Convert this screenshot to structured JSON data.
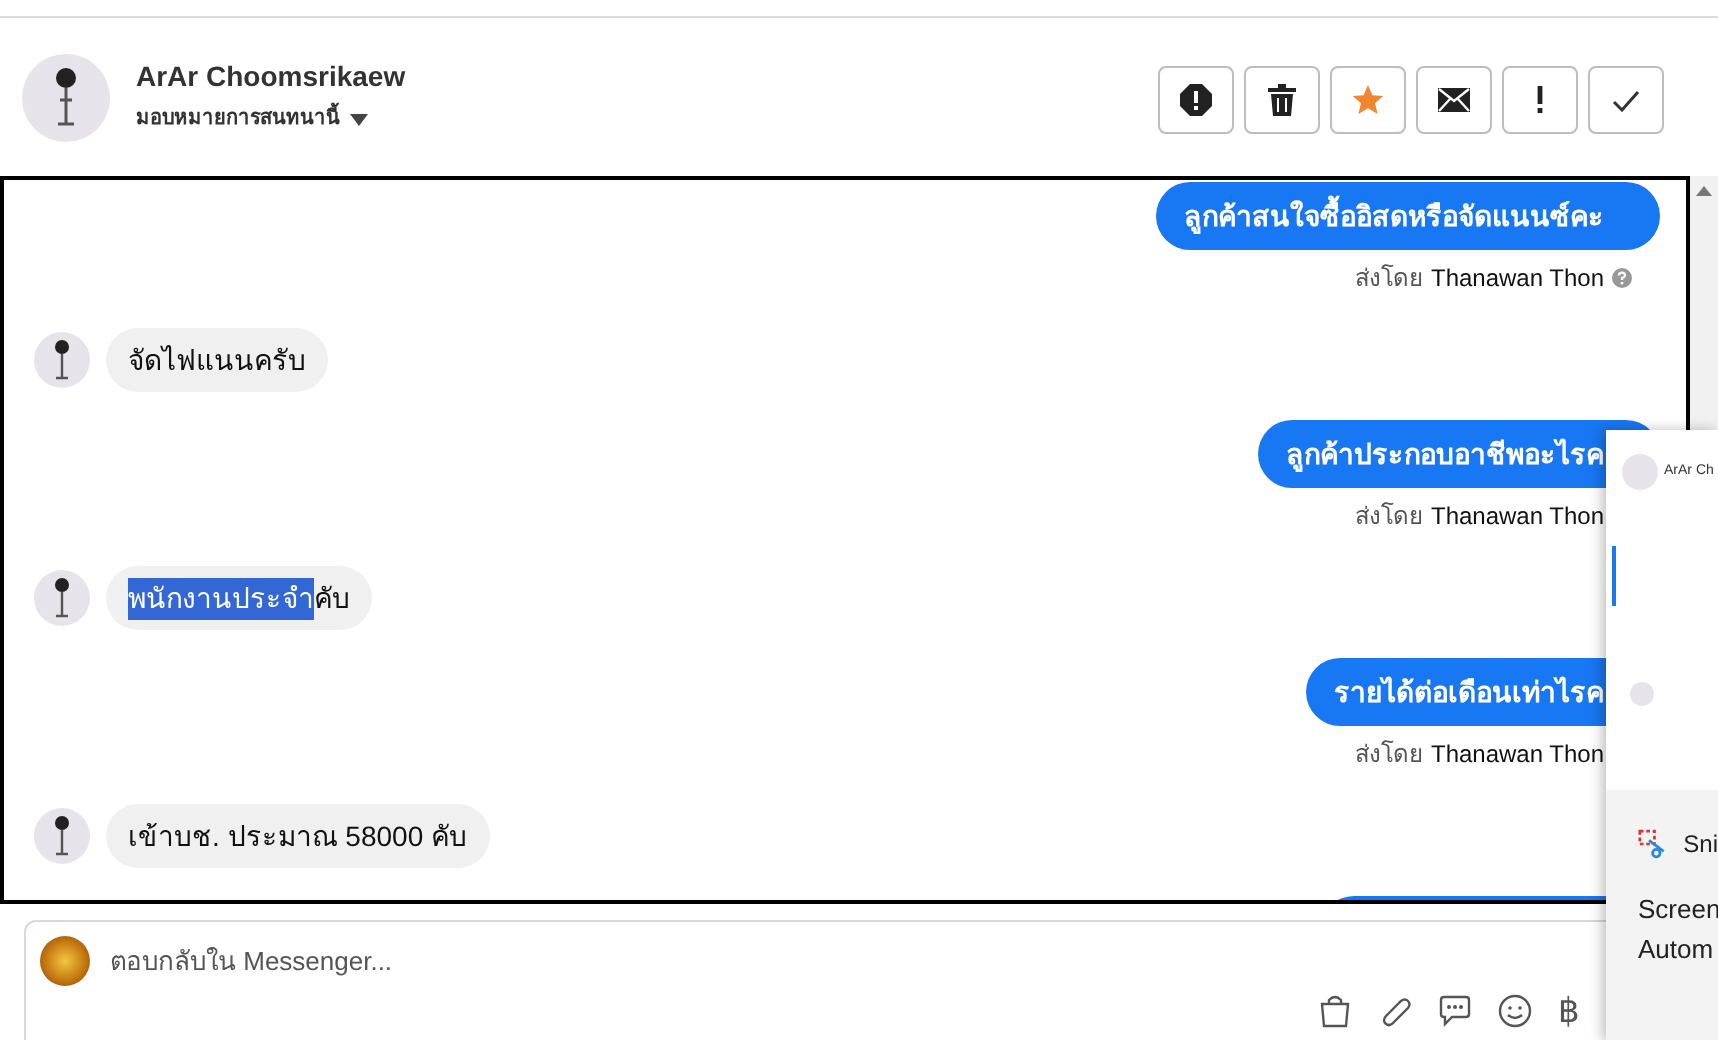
{
  "header": {
    "name": "ArAr Choomsrikaew",
    "assign_label": "มอบหมายการสนทนานี้",
    "actions": [
      {
        "kind": "spam",
        "active": false
      },
      {
        "kind": "delete",
        "active": false
      },
      {
        "kind": "star",
        "active": true
      },
      {
        "kind": "mail",
        "active": false
      },
      {
        "kind": "important",
        "active": false
      },
      {
        "kind": "done",
        "active": false
      }
    ]
  },
  "messages": [
    {
      "kind": "out",
      "parts": [
        {
          "text": "ลูกค้าสนใจซื้ออิสดหรือจัดแนนซ์คะ",
          "selected": false
        }
      ],
      "sent_by_label": "ส่งโดย",
      "sender": "Thanawan Thon",
      "help": true
    },
    {
      "kind": "in",
      "parts": [
        {
          "text": "จัดไฟแนนครับ",
          "selected": false
        }
      ]
    },
    {
      "kind": "out",
      "parts": [
        {
          "text": "ลูกค้าประกอบอาชีพอะไรค",
          "selected": false
        }
      ],
      "sent_by_label": "ส่งโดย",
      "sender": "Thanawan Thon"
    },
    {
      "kind": "in",
      "parts": [
        {
          "text": "พนักงานประจำ",
          "selected": true
        },
        {
          "text": "คับ",
          "selected": false
        }
      ]
    },
    {
      "kind": "out",
      "parts": [
        {
          "text": "รายได้ต่อเดือนเท่าไรค",
          "selected": false
        }
      ],
      "sent_by_label": "ส่งโดย",
      "sender": "Thanawan Thon"
    },
    {
      "kind": "in",
      "parts": [
        {
          "text": "เข้าบช. ประมาณ 58000 คับ",
          "selected": false
        }
      ]
    },
    {
      "kind": "out"
    }
  ],
  "composer": {
    "placeholder": "ตอบกลับใน Messenger...",
    "tools": [
      {
        "kind": "bag"
      },
      {
        "kind": "clip"
      },
      {
        "kind": "chat"
      },
      {
        "kind": "smile"
      },
      {
        "kind": "char",
        "text": "฿"
      }
    ]
  },
  "overlay": {
    "preview_name": "ArAr Ch",
    "app_name": "Sni",
    "lines": [
      "Screen",
      "Autom"
    ]
  }
}
